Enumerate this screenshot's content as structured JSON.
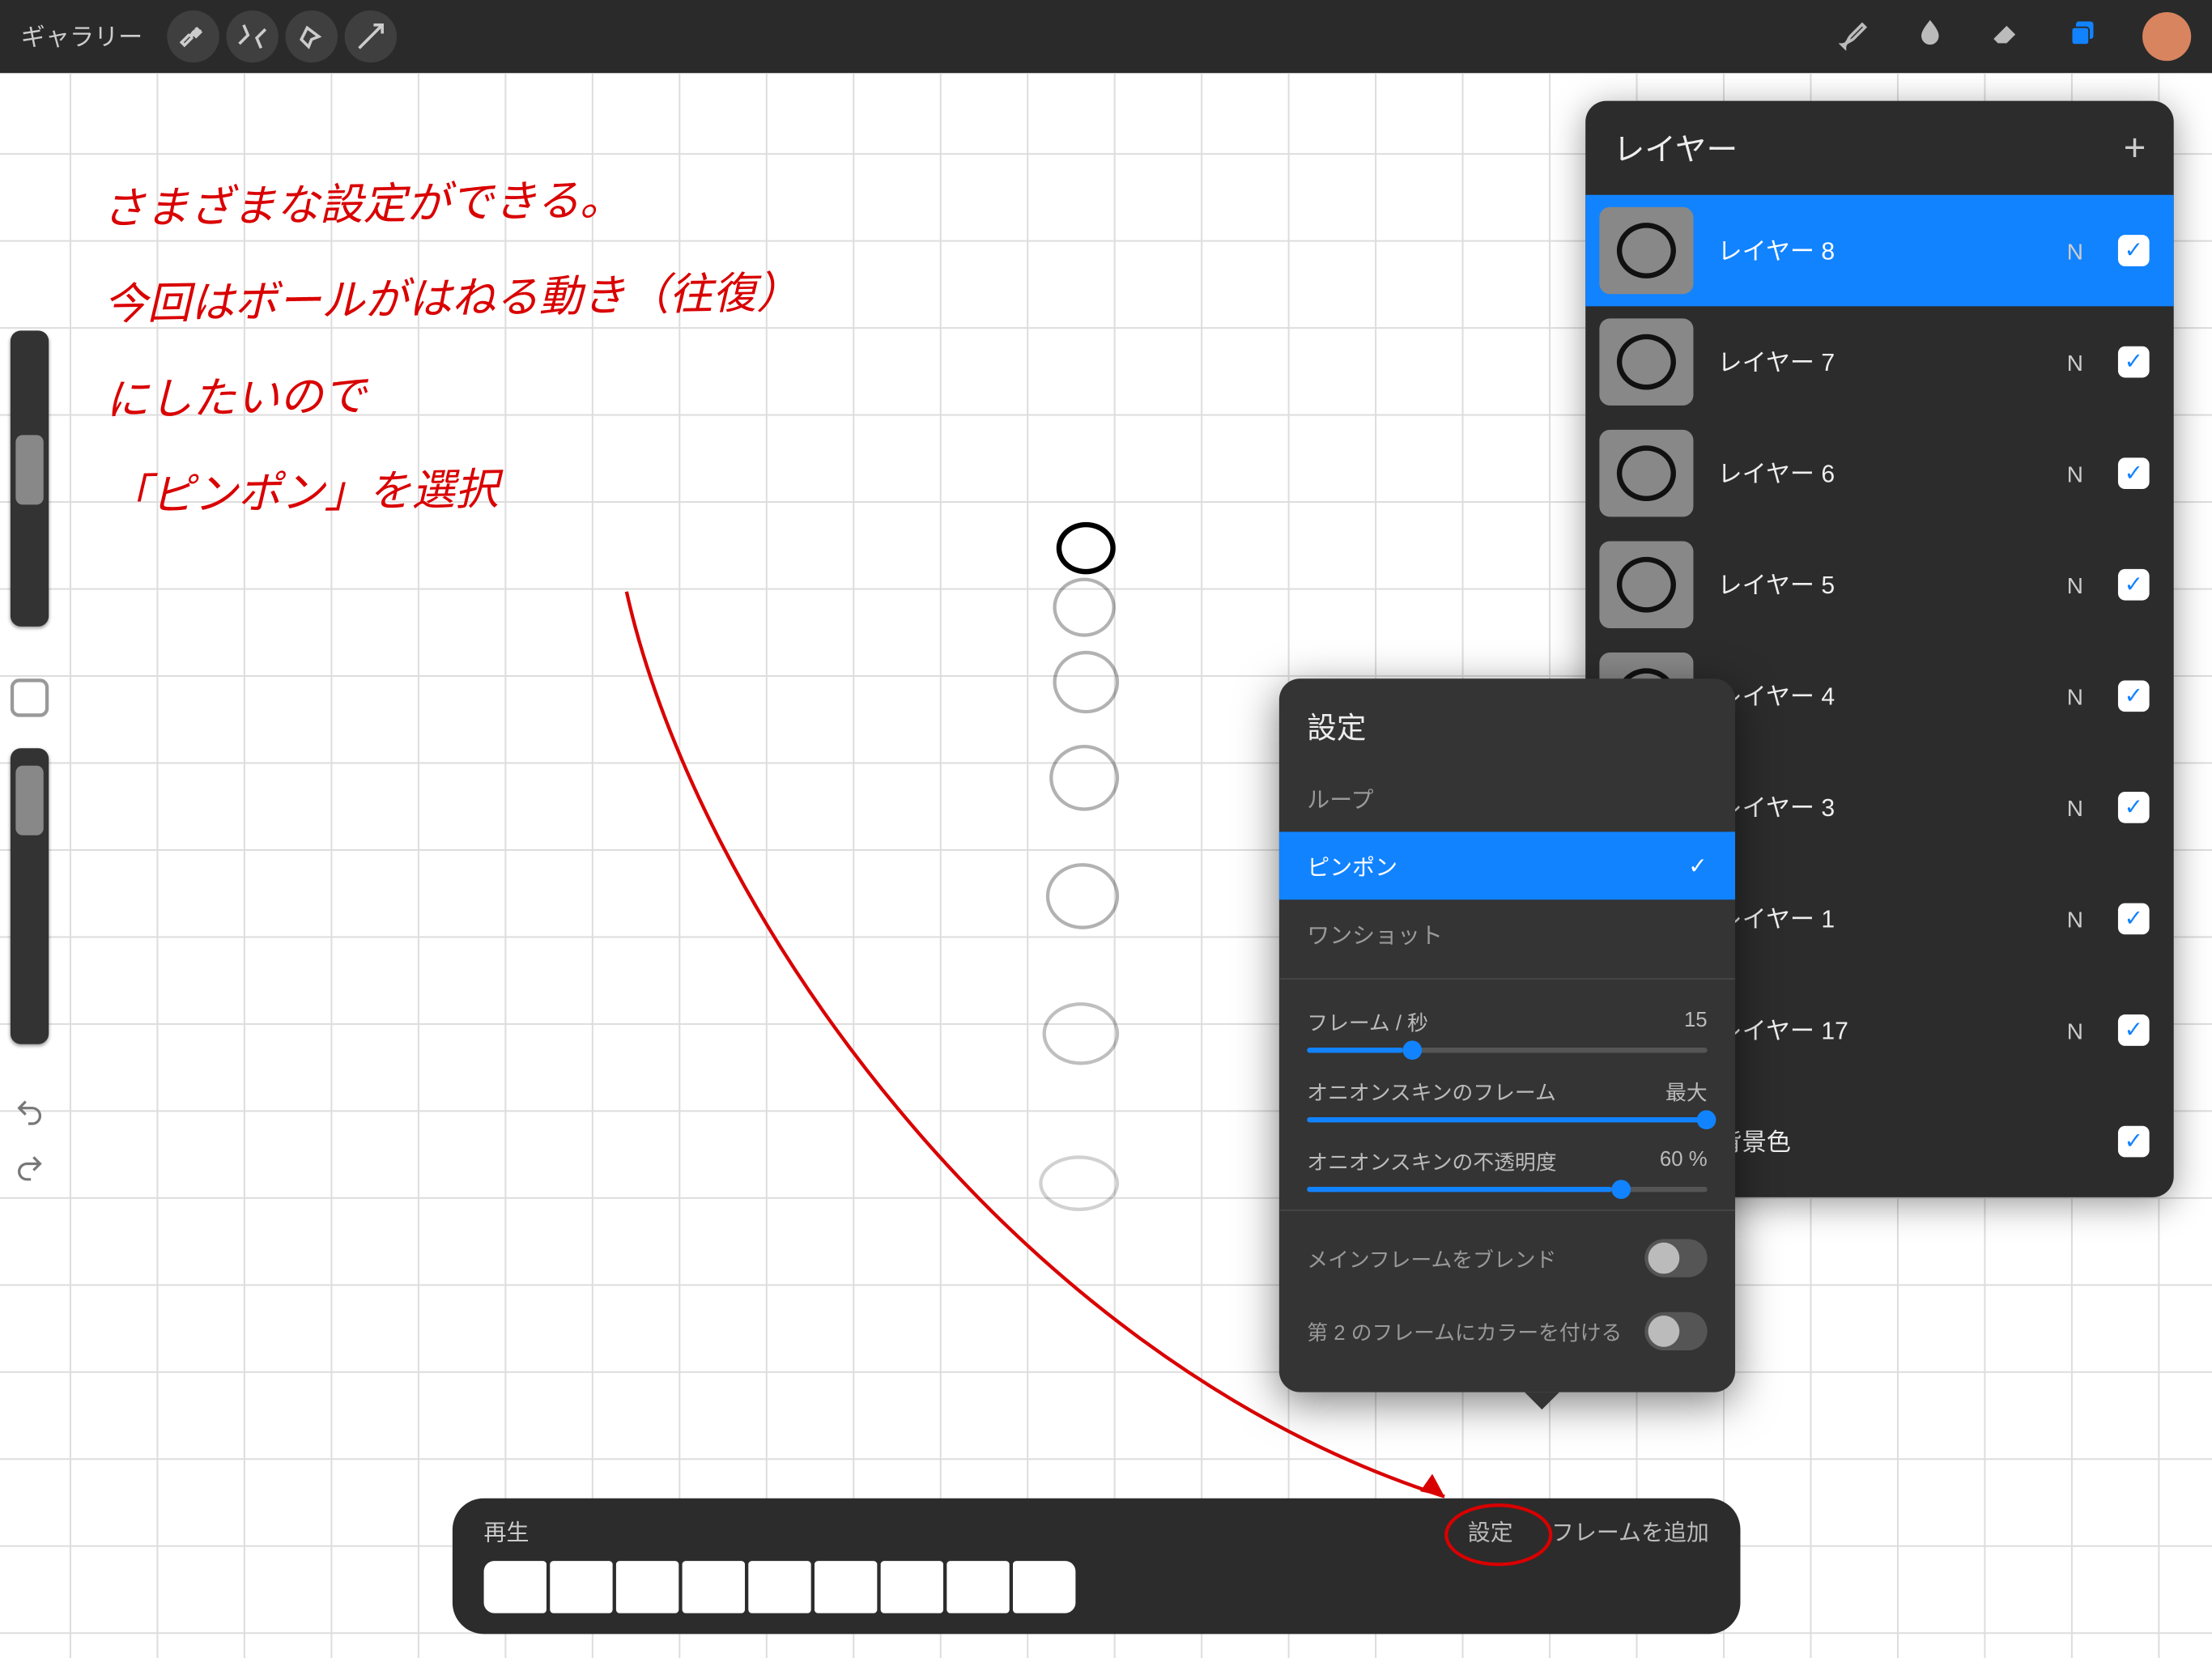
{
  "topbar": {
    "gallery": "ギャラリー"
  },
  "handwriting": {
    "line1": "さまざまな設定ができる。",
    "line2": "今回はボールがはねる動き（往復）",
    "line3": "にしたいので",
    "line4": "「ピンポン」を選択"
  },
  "layers_panel": {
    "title": "レイヤー",
    "rows": [
      {
        "name": "レイヤー 8",
        "blend": "N",
        "selected": true
      },
      {
        "name": "レイヤー 7",
        "blend": "N",
        "selected": false
      },
      {
        "name": "レイヤー 6",
        "blend": "N",
        "selected": false
      },
      {
        "name": "レイヤー 5",
        "blend": "N",
        "selected": false
      },
      {
        "name": "レイヤー 4",
        "blend": "N",
        "selected": false
      },
      {
        "name": "レイヤー 3",
        "blend": "N",
        "selected": false
      },
      {
        "name": "レイヤー 1",
        "blend": "N",
        "selected": false
      },
      {
        "name": "レイヤー 17",
        "blend": "N",
        "selected": false
      }
    ],
    "background": "背景色"
  },
  "settings": {
    "title": "設定",
    "options": {
      "loop": "ループ",
      "pingpong": "ピンポン",
      "oneshot": "ワンショット"
    },
    "fps_label": "フレーム / 秒",
    "fps_value": "15",
    "onion_frames_label": "オニオンスキンのフレーム",
    "onion_frames_value": "最大",
    "onion_opacity_label": "オニオンスキンの不透明度",
    "onion_opacity_value": "60 %",
    "blend_main": "メインフレームをブレンド",
    "color_secondary": "第 2 のフレームにカラーを付ける"
  },
  "timeline": {
    "play": "再生",
    "settings": "設定",
    "add_frame": "フレームを追加"
  },
  "colors": {
    "accent": "#1183ff",
    "annotation": "#d90000",
    "swatch": "#d8845f"
  }
}
